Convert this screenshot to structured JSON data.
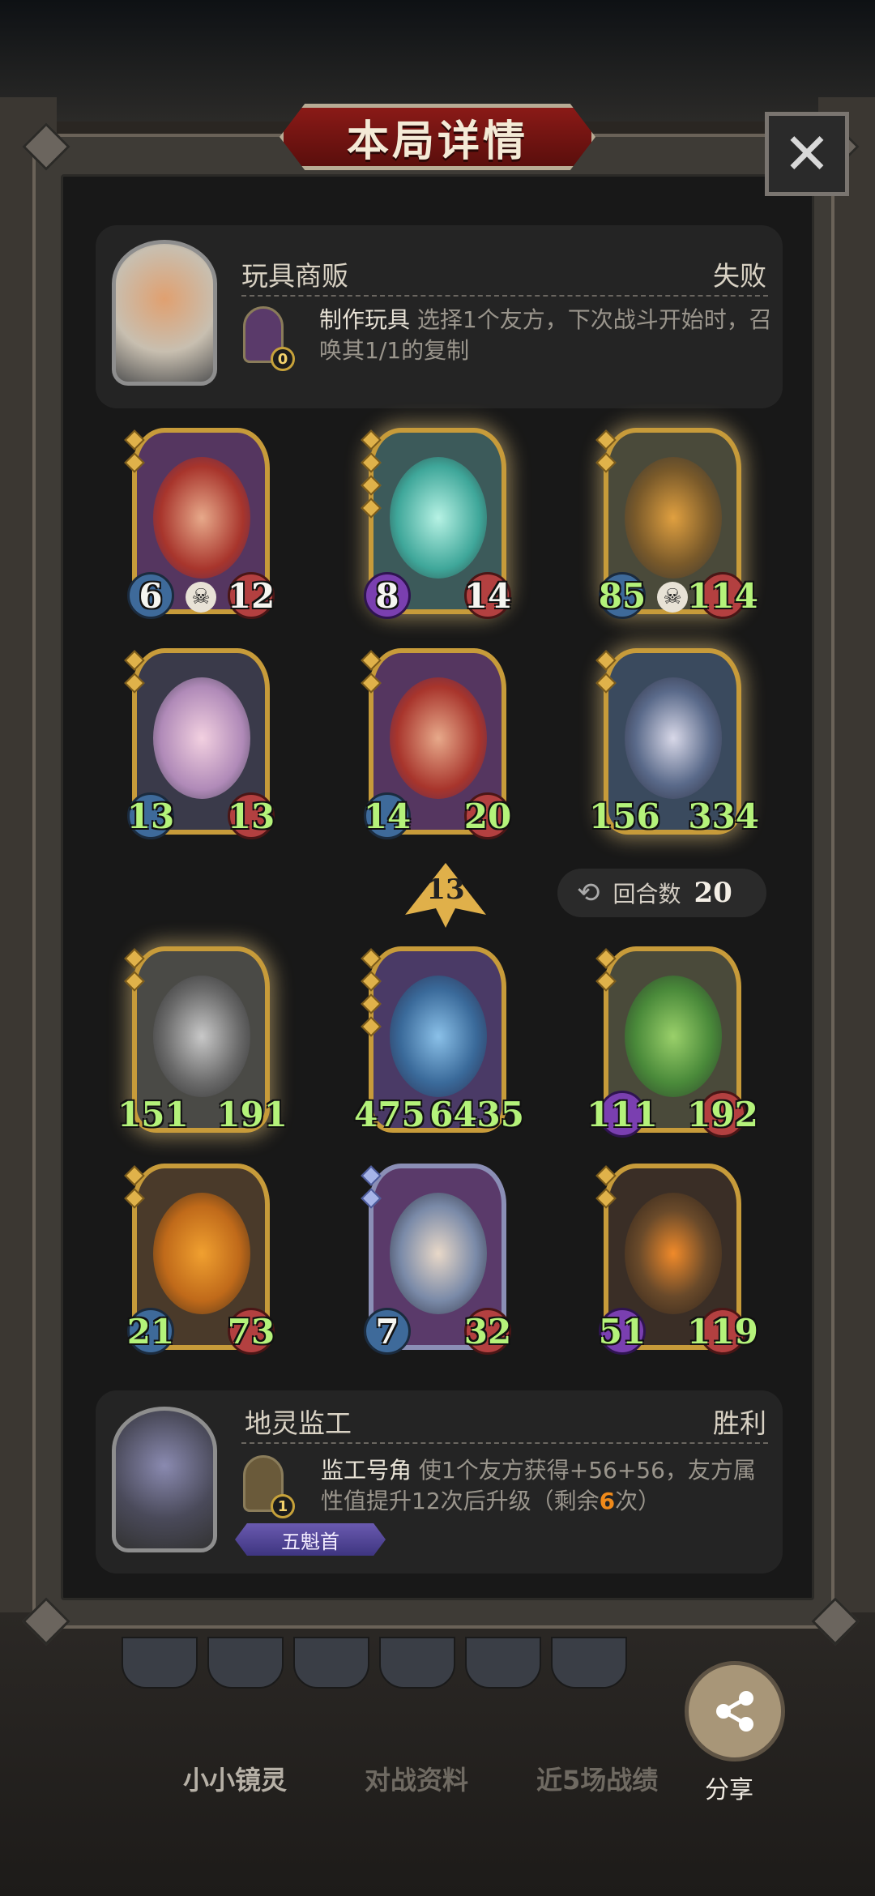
{
  "title": "本局详情",
  "close_icon": "close-icon",
  "opponent": {
    "name": "玩具商贩",
    "result": "失败",
    "relic_count": "0",
    "skill_name": "制作玩具",
    "skill_desc": "选择1个友方，下次战斗开始时，召唤其1/1的复制"
  },
  "units_top": [
    {
      "atk": "6",
      "hp": "12"
    },
    {
      "atk": "8",
      "hp": "14"
    },
    {
      "atk": "85",
      "hp": "114"
    },
    {
      "atk": "13",
      "hp": "13"
    },
    {
      "atk": "14",
      "hp": "20"
    },
    {
      "atk": "156",
      "hp": "334"
    }
  ],
  "tier": "13",
  "rounds": {
    "label": "回合数",
    "value": "20"
  },
  "units_bottom": [
    {
      "atk": "151",
      "hp": "191"
    },
    {
      "atk": "475",
      "hp": "6435"
    },
    {
      "atk": "111",
      "hp": "192"
    },
    {
      "atk": "21",
      "hp": "73"
    },
    {
      "atk": "7",
      "hp": "32"
    },
    {
      "atk": "51",
      "hp": "119"
    }
  ],
  "player": {
    "name": "地灵监工",
    "result": "胜利",
    "relic_count": "1",
    "skill_name": "监工号角",
    "skill_desc_a": "使1个友方获得+56+56，友方属性值提升12次后升级（剩余",
    "skill_remaining": "6",
    "skill_desc_b": "次）",
    "rank_badge": "五魁首"
  },
  "tabs": [
    "小小镜灵",
    "对战资料",
    "近5场战绩"
  ],
  "share_label": "分享",
  "colors": {
    "gold_frame": "#c79b3a",
    "result_text": "#d9d2c4",
    "highlight": "#f08a1a",
    "green_stat": "#b4f27a"
  }
}
